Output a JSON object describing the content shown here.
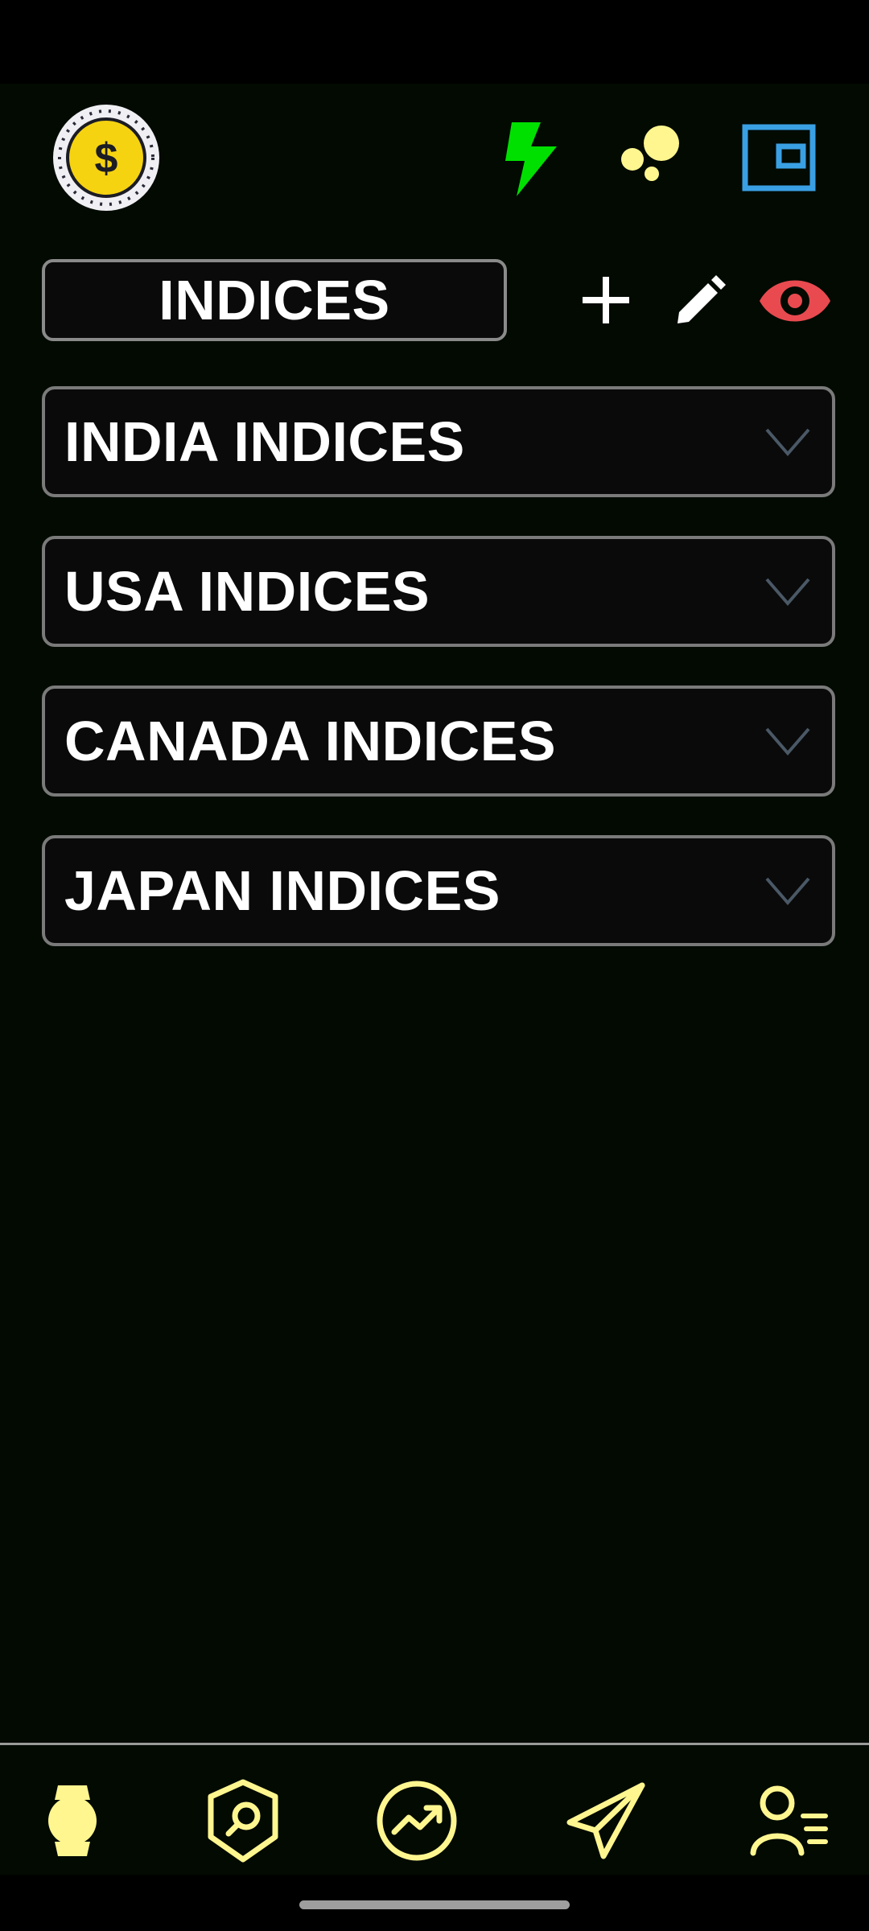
{
  "header": {
    "title": "INDICES",
    "logo_icon": "dollar-coin-icon",
    "icons": [
      "flash-icon",
      "bubbles-icon",
      "wallet-icon"
    ],
    "actions": [
      "add-icon",
      "edit-icon",
      "eye-icon"
    ]
  },
  "groups": [
    {
      "label": "INDIA INDICES"
    },
    {
      "label": "USA INDICES"
    },
    {
      "label": "CANADA INDICES"
    },
    {
      "label": "JAPAN INDICES"
    }
  ],
  "bottom_nav": {
    "items": [
      "watch-icon",
      "shield-search-icon",
      "trend-icon",
      "send-icon",
      "profile-list-icon"
    ]
  },
  "colors": {
    "background": "#020a02",
    "accent_yellow": "#fff68f",
    "coin_gold": "#f5d311",
    "flash_green": "#00e000",
    "wallet_blue": "#3aa0e4",
    "eye_red": "#e84a4f",
    "chevron": "#4a5866"
  }
}
